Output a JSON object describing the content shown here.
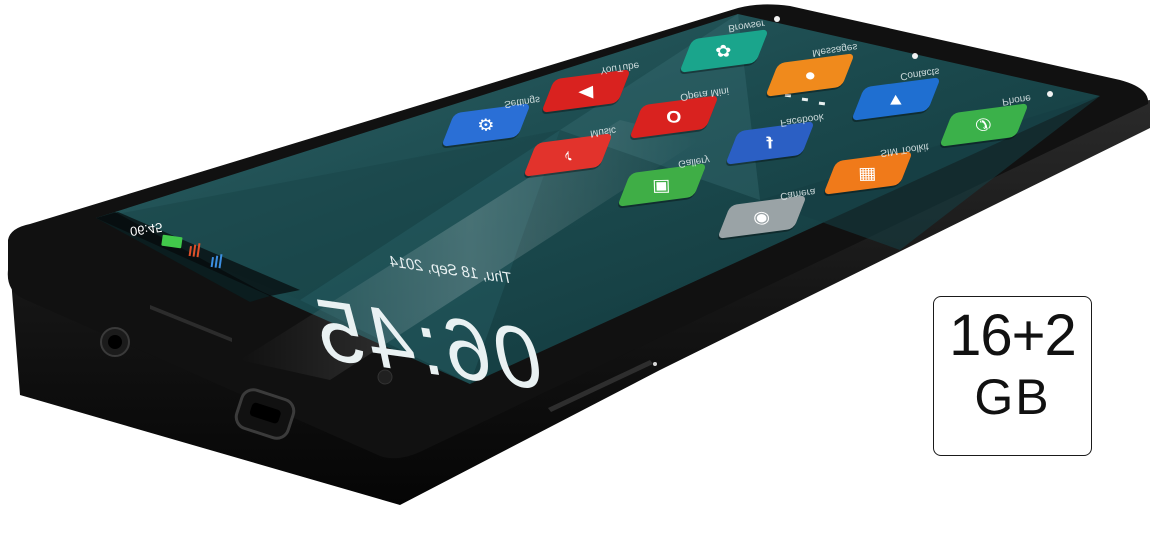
{
  "badge": {
    "capacity": "16+2",
    "unit": "GB"
  },
  "lock_screen": {
    "clock": "06:45",
    "date": "Thu, 18 Sep, 2014"
  },
  "status_bar": {
    "time": "06:45"
  },
  "apps": [
    {
      "label": "Browser",
      "icon": "browser-icon",
      "color": "#1aa58c"
    },
    {
      "label": "Messages",
      "icon": "messages-icon",
      "color": "#f08a1c"
    },
    {
      "label": "Contacts",
      "icon": "contacts-icon",
      "color": "#1f6fd1"
    },
    {
      "label": "Phone",
      "icon": "phone-icon",
      "color": "#3bb14a"
    },
    {
      "label": "YouTube",
      "icon": "youtube-icon",
      "color": "#d9221f"
    },
    {
      "label": "Opera Mini",
      "icon": "opera-icon",
      "color": "#d9221f"
    },
    {
      "label": "Facebook",
      "icon": "facebook-icon",
      "color": "#2b5fc4"
    },
    {
      "label": "SIM Toolkit",
      "icon": "sim-icon",
      "color": "#f07a1a"
    },
    {
      "label": "Settings",
      "icon": "gear-icon",
      "color": "#2a6fd6"
    },
    {
      "label": "Music",
      "icon": "music-icon",
      "color": "#e2332c"
    },
    {
      "label": "Gallery",
      "icon": "gallery-icon",
      "color": "#3fae46"
    },
    {
      "label": "Camera",
      "icon": "camera-icon",
      "color": "#9aa3a6"
    }
  ]
}
